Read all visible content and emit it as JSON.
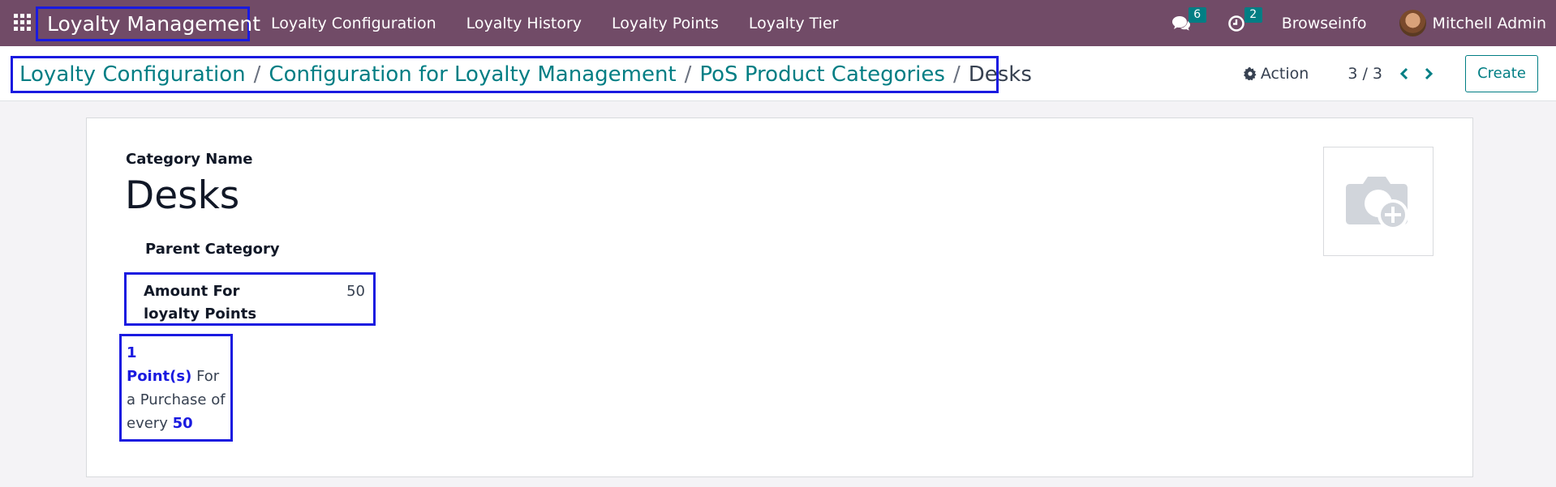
{
  "navbar": {
    "app_name": "Loyalty Management",
    "menu": [
      "Loyalty Configuration",
      "Loyalty History",
      "Loyalty Points",
      "Loyalty Tier"
    ],
    "messages_count": "6",
    "activities_count": "2",
    "company": "Browseinfo",
    "user_name": "Mitchell Admin"
  },
  "breadcrumb": {
    "items": [
      "Loyalty Configuration",
      "Configuration for Loyalty Management",
      "PoS Product Categories"
    ],
    "separator": "/",
    "current": "Desks"
  },
  "control_panel": {
    "action_label": "Action",
    "pager": "3 / 3",
    "create_label": "Create"
  },
  "form": {
    "category_name_label": "Category Name",
    "category_name": "Desks",
    "parent_category_label": "Parent Category",
    "amount_label": "Amount For loyalty Points",
    "amount_value": "50",
    "points_text": {
      "points": "1",
      "points_unit": "Point(s)",
      "middle": "For a Purchase of every",
      "amount": "50"
    }
  },
  "colors": {
    "navbar_bg": "#714b67",
    "accent": "#017e84",
    "highlight_border": "#1a1ae0"
  },
  "icons": [
    "apps-grid-icon",
    "chat-icon",
    "clock-icon",
    "gear-icon",
    "chevron-left-icon",
    "chevron-right-icon",
    "camera-add-icon"
  ]
}
